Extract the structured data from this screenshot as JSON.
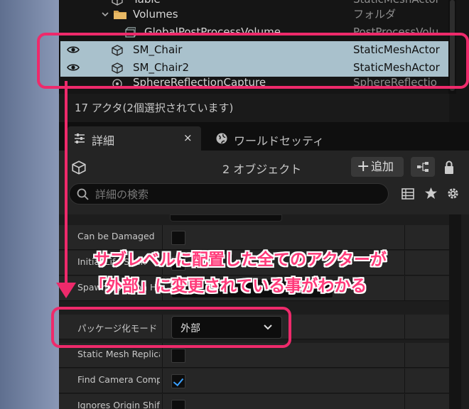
{
  "outliner": {
    "rows": [
      {
        "name": "Table",
        "type": "StaticMeshActor"
      },
      {
        "name": "Volumes",
        "type": "フォルダ"
      },
      {
        "name": "GlobalPostProcessVolume",
        "type": "PostProcessVolu"
      },
      {
        "name": "SM_Chair",
        "type": "StaticMeshActor"
      },
      {
        "name": "SM_Chair2",
        "type": "StaticMeshActor"
      },
      {
        "name": "SphereReflectionCapture",
        "type": "SphereReflectio"
      }
    ],
    "status": "17 アクタ(2個選択されています)"
  },
  "tabs": {
    "details": "詳細",
    "details_close": "×",
    "world": "ワールドセッティ"
  },
  "details": {
    "object_count": "2 オブジェクト",
    "add_label": "追加",
    "search_placeholder": "詳細の検索"
  },
  "properties": [
    {
      "label": "Can be Damaged",
      "checked": false
    },
    {
      "label": "Initial Life Span",
      "checked": false
    },
    {
      "label": "Spawn Collision Handling Method",
      "checked": false
    },
    {
      "label": "パッケージ化モード",
      "value": "外部"
    },
    {
      "label": "Static Mesh Replicat",
      "checked": false
    },
    {
      "label": "Find Camera Compo",
      "checked": true
    },
    {
      "label": "Ignores Origin Shifti",
      "checked": false
    }
  ],
  "annotation": {
    "line1": "サブレベルに配置した全てのアクターが",
    "line2": "「外部」に変更されている事がわかる"
  },
  "colors": {
    "highlight": "#ee2a6b",
    "selection": "#a9c1cc",
    "panel_bg": "#151515",
    "checkbox_accent": "#3aa0ff"
  }
}
